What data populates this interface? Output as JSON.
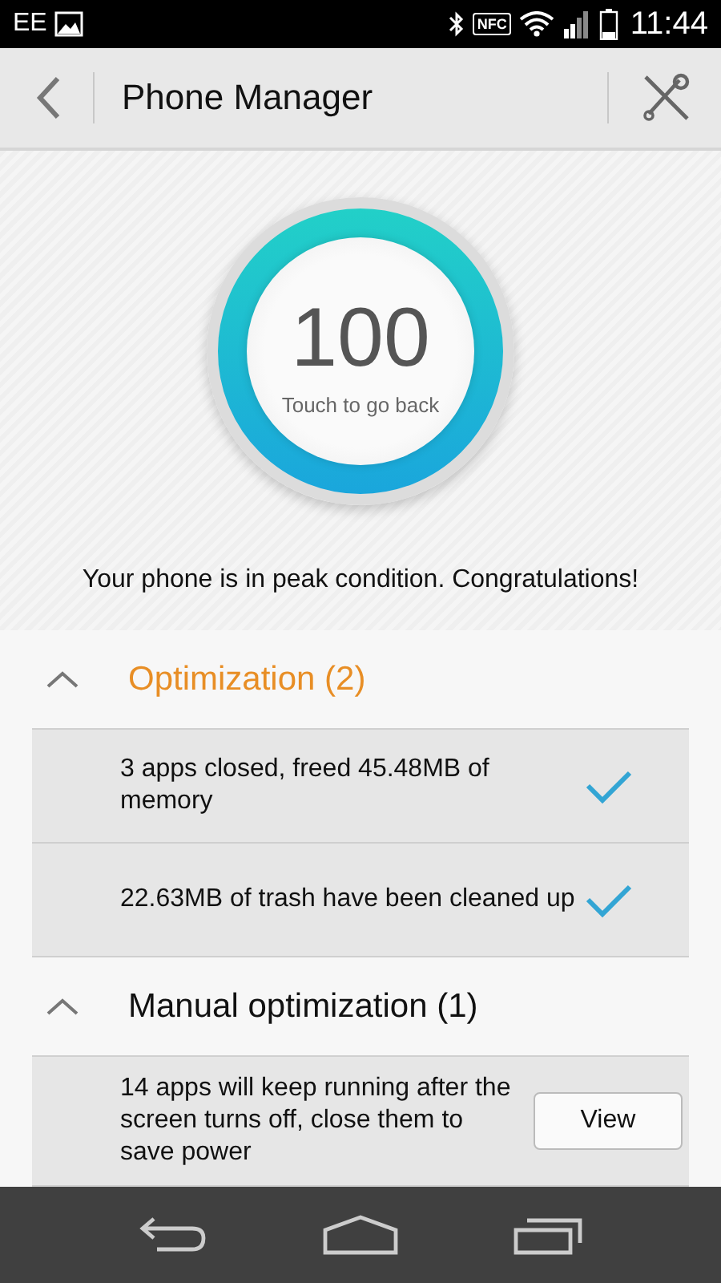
{
  "status_bar": {
    "carrier": "EE",
    "nfc": "NFC",
    "time": "11:44"
  },
  "app_bar": {
    "title": "Phone Manager"
  },
  "score": {
    "value": "100",
    "hint": "Touch to go back"
  },
  "message": "Your phone is in peak condition. Congratulations!",
  "sections": [
    {
      "title": "Optimization (2)",
      "expanded": true,
      "highlighted": true,
      "items": [
        {
          "kind": "done",
          "text": "3 apps closed, freed 45.48MB of memory"
        },
        {
          "kind": "done",
          "text": "22.63MB of trash have been cleaned up"
        }
      ]
    },
    {
      "title": "Manual optimization (1)",
      "expanded": true,
      "highlighted": false,
      "items": [
        {
          "kind": "action",
          "text": "14 apps will keep running after the screen turns off, close them to save power",
          "button": "View"
        }
      ]
    }
  ]
}
